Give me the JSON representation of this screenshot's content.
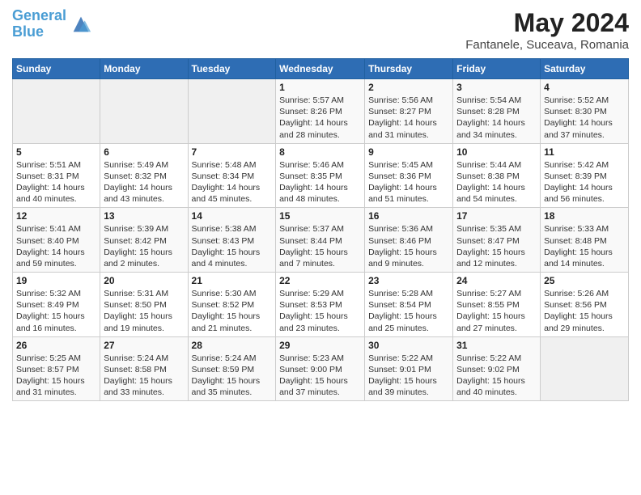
{
  "header": {
    "logo_line1": "General",
    "logo_line2": "Blue",
    "title": "May 2024",
    "subtitle": "Fantanele, Suceava, Romania"
  },
  "columns": [
    "Sunday",
    "Monday",
    "Tuesday",
    "Wednesday",
    "Thursday",
    "Friday",
    "Saturday"
  ],
  "weeks": [
    [
      {
        "day": "",
        "detail": ""
      },
      {
        "day": "",
        "detail": ""
      },
      {
        "day": "",
        "detail": ""
      },
      {
        "day": "1",
        "detail": "Sunrise: 5:57 AM\nSunset: 8:26 PM\nDaylight: 14 hours\nand 28 minutes."
      },
      {
        "day": "2",
        "detail": "Sunrise: 5:56 AM\nSunset: 8:27 PM\nDaylight: 14 hours\nand 31 minutes."
      },
      {
        "day": "3",
        "detail": "Sunrise: 5:54 AM\nSunset: 8:28 PM\nDaylight: 14 hours\nand 34 minutes."
      },
      {
        "day": "4",
        "detail": "Sunrise: 5:52 AM\nSunset: 8:30 PM\nDaylight: 14 hours\nand 37 minutes."
      }
    ],
    [
      {
        "day": "5",
        "detail": "Sunrise: 5:51 AM\nSunset: 8:31 PM\nDaylight: 14 hours\nand 40 minutes."
      },
      {
        "day": "6",
        "detail": "Sunrise: 5:49 AM\nSunset: 8:32 PM\nDaylight: 14 hours\nand 43 minutes."
      },
      {
        "day": "7",
        "detail": "Sunrise: 5:48 AM\nSunset: 8:34 PM\nDaylight: 14 hours\nand 45 minutes."
      },
      {
        "day": "8",
        "detail": "Sunrise: 5:46 AM\nSunset: 8:35 PM\nDaylight: 14 hours\nand 48 minutes."
      },
      {
        "day": "9",
        "detail": "Sunrise: 5:45 AM\nSunset: 8:36 PM\nDaylight: 14 hours\nand 51 minutes."
      },
      {
        "day": "10",
        "detail": "Sunrise: 5:44 AM\nSunset: 8:38 PM\nDaylight: 14 hours\nand 54 minutes."
      },
      {
        "day": "11",
        "detail": "Sunrise: 5:42 AM\nSunset: 8:39 PM\nDaylight: 14 hours\nand 56 minutes."
      }
    ],
    [
      {
        "day": "12",
        "detail": "Sunrise: 5:41 AM\nSunset: 8:40 PM\nDaylight: 14 hours\nand 59 minutes."
      },
      {
        "day": "13",
        "detail": "Sunrise: 5:39 AM\nSunset: 8:42 PM\nDaylight: 15 hours\nand 2 minutes."
      },
      {
        "day": "14",
        "detail": "Sunrise: 5:38 AM\nSunset: 8:43 PM\nDaylight: 15 hours\nand 4 minutes."
      },
      {
        "day": "15",
        "detail": "Sunrise: 5:37 AM\nSunset: 8:44 PM\nDaylight: 15 hours\nand 7 minutes."
      },
      {
        "day": "16",
        "detail": "Sunrise: 5:36 AM\nSunset: 8:46 PM\nDaylight: 15 hours\nand 9 minutes."
      },
      {
        "day": "17",
        "detail": "Sunrise: 5:35 AM\nSunset: 8:47 PM\nDaylight: 15 hours\nand 12 minutes."
      },
      {
        "day": "18",
        "detail": "Sunrise: 5:33 AM\nSunset: 8:48 PM\nDaylight: 15 hours\nand 14 minutes."
      }
    ],
    [
      {
        "day": "19",
        "detail": "Sunrise: 5:32 AM\nSunset: 8:49 PM\nDaylight: 15 hours\nand 16 minutes."
      },
      {
        "day": "20",
        "detail": "Sunrise: 5:31 AM\nSunset: 8:50 PM\nDaylight: 15 hours\nand 19 minutes."
      },
      {
        "day": "21",
        "detail": "Sunrise: 5:30 AM\nSunset: 8:52 PM\nDaylight: 15 hours\nand 21 minutes."
      },
      {
        "day": "22",
        "detail": "Sunrise: 5:29 AM\nSunset: 8:53 PM\nDaylight: 15 hours\nand 23 minutes."
      },
      {
        "day": "23",
        "detail": "Sunrise: 5:28 AM\nSunset: 8:54 PM\nDaylight: 15 hours\nand 25 minutes."
      },
      {
        "day": "24",
        "detail": "Sunrise: 5:27 AM\nSunset: 8:55 PM\nDaylight: 15 hours\nand 27 minutes."
      },
      {
        "day": "25",
        "detail": "Sunrise: 5:26 AM\nSunset: 8:56 PM\nDaylight: 15 hours\nand 29 minutes."
      }
    ],
    [
      {
        "day": "26",
        "detail": "Sunrise: 5:25 AM\nSunset: 8:57 PM\nDaylight: 15 hours\nand 31 minutes."
      },
      {
        "day": "27",
        "detail": "Sunrise: 5:24 AM\nSunset: 8:58 PM\nDaylight: 15 hours\nand 33 minutes."
      },
      {
        "day": "28",
        "detail": "Sunrise: 5:24 AM\nSunset: 8:59 PM\nDaylight: 15 hours\nand 35 minutes."
      },
      {
        "day": "29",
        "detail": "Sunrise: 5:23 AM\nSunset: 9:00 PM\nDaylight: 15 hours\nand 37 minutes."
      },
      {
        "day": "30",
        "detail": "Sunrise: 5:22 AM\nSunset: 9:01 PM\nDaylight: 15 hours\nand 39 minutes."
      },
      {
        "day": "31",
        "detail": "Sunrise: 5:22 AM\nSunset: 9:02 PM\nDaylight: 15 hours\nand 40 minutes."
      },
      {
        "day": "",
        "detail": ""
      }
    ]
  ]
}
